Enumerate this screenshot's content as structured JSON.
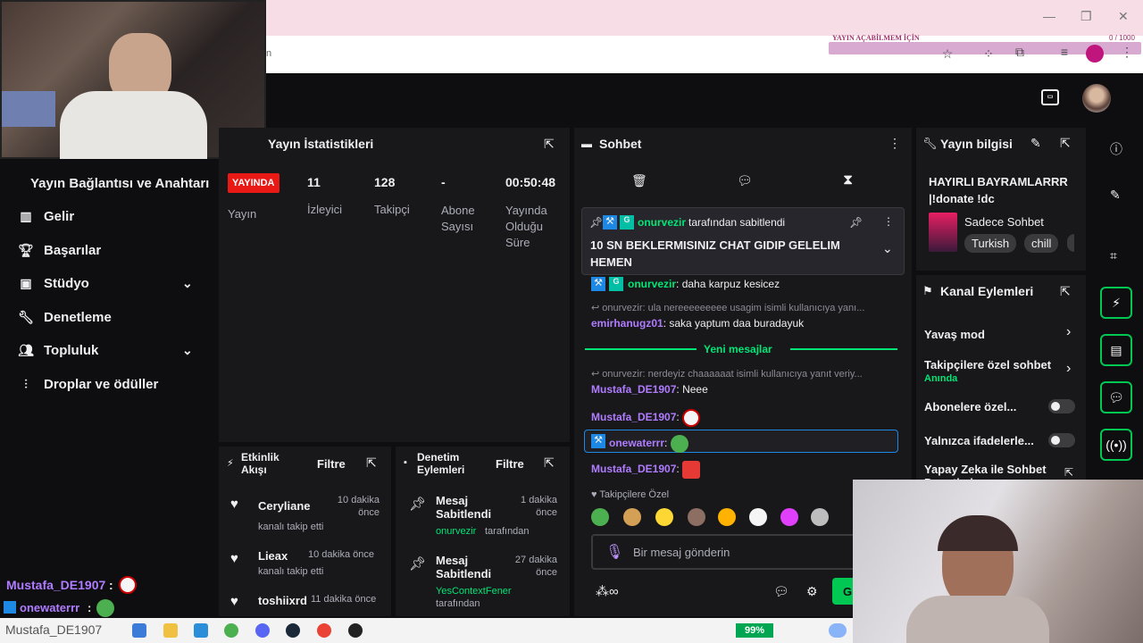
{
  "overlay": {
    "goal_title": "YAYIN AÇABİLMEM İÇİN",
    "goal_count": "0 / 1000"
  },
  "stats": {
    "title": "Yayın İstatistikleri",
    "status_badge": "YAYINDA",
    "status_label": "Yayın",
    "viewers_value": "11",
    "viewers_label": "İzleyici",
    "followers_value": "128",
    "followers_label": "Takipçi",
    "subs_value": "-",
    "subs_label": "Abone Sayısı",
    "uptime_value": "00:50:48",
    "uptime_label": "Yayında Olduğu Süre"
  },
  "sidebar": {
    "items": [
      {
        "label": "Yayın Bağlantısı ve Anahtarı"
      },
      {
        "label": "Gelir"
      },
      {
        "label": "Başarılar"
      },
      {
        "label": "Stüdyo"
      },
      {
        "label": "Denetleme"
      },
      {
        "label": "Topluluk"
      },
      {
        "label": "Droplar ve ödüller"
      }
    ]
  },
  "activity": {
    "title": "Etkinlik Akışı",
    "filter_label": "Filtre",
    "events": [
      {
        "user": "Ceryliane",
        "desc": "kanalı takip etti",
        "time": "10 dakika önce"
      },
      {
        "user": "Lieax",
        "desc": "kanalı takip etti",
        "time": "10 dakika önce"
      },
      {
        "user": "toshiixrd",
        "desc": "",
        "time": "11 dakika önce"
      }
    ]
  },
  "moderation": {
    "title": "Denetim Eylemleri",
    "filter_label": "Filtre",
    "actions": [
      {
        "action": "Mesaj Sabitlendi",
        "by": "onurvezir",
        "suffix": "tarafından",
        "time": "1 dakika önce"
      },
      {
        "action": "Mesaj Sabitlendi",
        "by": "YesContextFener",
        "suffix": "tarafından",
        "time": "27 dakika önce"
      }
    ]
  },
  "chat": {
    "title": "Sohbet",
    "pinned_by": "onurvezir",
    "pinned_suffix": "tarafından sabitlendi",
    "pinned_text": "10 SN BEKLERMISINIZ CHAT GIDIP GELELIM HEMEN",
    "messages": [
      {
        "user": "onurvezir",
        "text": "daha karpuz kesicez"
      },
      {
        "reply": "onurvezir: ula nereeeeeeeee usagim isimli kullanıcıya yanı...",
        "user": "emirhanugz01",
        "text": "saka yaptum daa buradayuk"
      },
      {
        "reply": "onurvezir: nerdeyiz chaaaaaat isimli kullanıcıya yanıt veriy...",
        "user": "Mustafa_DE1907",
        "text": "Neee"
      },
      {
        "user": "Mustafa_DE1907",
        "text": ""
      },
      {
        "user": "onewaterrr",
        "text": ""
      },
      {
        "user": "Mustafa_DE1907",
        "text": ""
      }
    ],
    "new_messages_label": "Yeni mesajlar",
    "followers_only_label": "Takipçilere Özel",
    "input_placeholder": "Bir mesaj gönderin",
    "send_label": "G"
  },
  "stream_info": {
    "title": "Yayın bilgisi",
    "stream_title_line1": "HAYIRLI BAYRAMLARRR",
    "stream_title_line2": "|!donate !dc",
    "category": "Sadece Sohbet",
    "tags": [
      "Turkish",
      "chill"
    ]
  },
  "channel_actions": {
    "title": "Kanal Eylemleri",
    "items": [
      {
        "label": "Yavaş mod",
        "sub": ""
      },
      {
        "label": "Takipçilere özel sohbet",
        "sub": "Anında"
      },
      {
        "label": "Abonelere özel...",
        "sub": ""
      },
      {
        "label": "Yalnızca ifadelerle...",
        "sub": ""
      },
      {
        "label": "Yapay Zeka ile Sohbet Denetimi",
        "sub": ""
      }
    ]
  },
  "overlay_chat": [
    {
      "user": "Mustafa_DE1907",
      "sep": ":"
    },
    {
      "user": "onewaterrr",
      "sep": ":"
    }
  ],
  "taskbar": {
    "battery": "99%",
    "ghost_text": "Mustafa_DE1907"
  },
  "colors": {
    "accent": "#00c853",
    "live": "#e91916",
    "twitch_purple": "#bf94ff",
    "chat_green": "#00e676"
  }
}
